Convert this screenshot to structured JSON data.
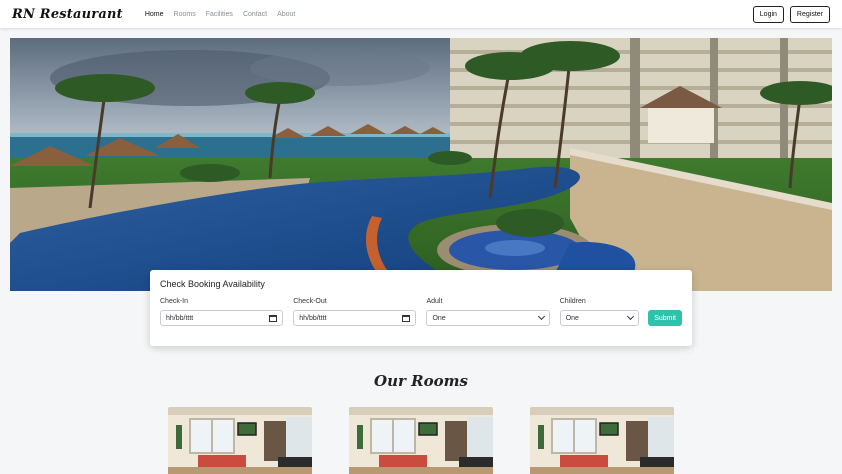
{
  "navbar": {
    "brand": "RN Restaurant",
    "links": [
      "Home",
      "Rooms",
      "Facilities",
      "Contact",
      "About"
    ],
    "active_link": "Home",
    "login_label": "Login",
    "register_label": "Register"
  },
  "booking": {
    "title": "Check Booking Availability",
    "checkin_label": "Check-In",
    "checkin_value": "hh/bb/tttt",
    "checkout_label": "Check-Out",
    "checkout_value": "hh/bb/tttt",
    "adult_label": "Adult",
    "adult_value": "One",
    "children_label": "Children",
    "children_value": "One",
    "submit_label": "Submit"
  },
  "rooms": {
    "title": "Our Rooms"
  },
  "colors": {
    "accent": "#2ec1ac",
    "text": "#222222",
    "background": "#f5f6f8"
  }
}
